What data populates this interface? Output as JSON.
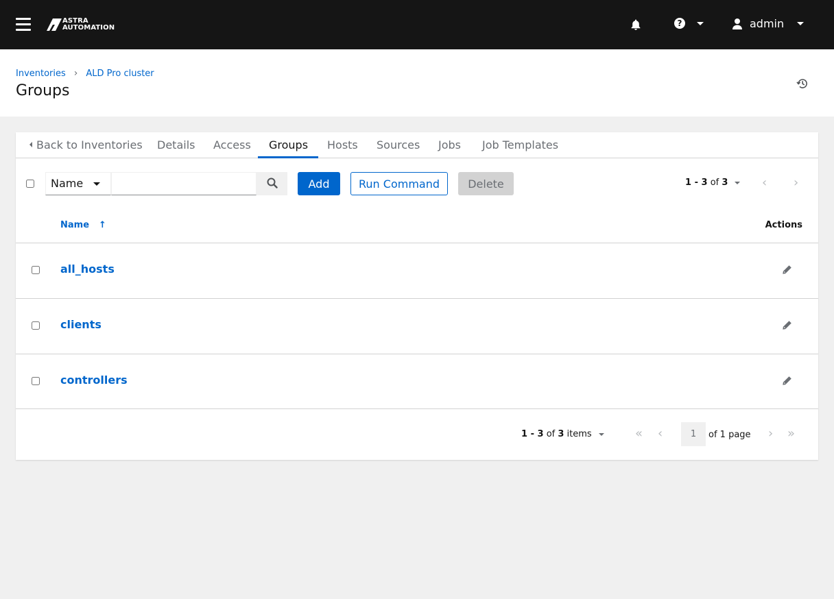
{
  "header": {
    "logo_line1": "ASTRA",
    "logo_line2": "AUTOMATION",
    "user_name": "admin",
    "help_glyph": "?"
  },
  "breadcrumb": {
    "items": [
      "Inventories",
      "ALD Pro cluster"
    ],
    "separator": "›"
  },
  "page_title": "Groups",
  "tabs": [
    {
      "label": "Back to Inventories",
      "active": false
    },
    {
      "label": "Details",
      "active": false
    },
    {
      "label": "Access",
      "active": false
    },
    {
      "label": "Groups",
      "active": true
    },
    {
      "label": "Hosts",
      "active": false
    },
    {
      "label": "Sources",
      "active": false
    },
    {
      "label": "Jobs",
      "active": false
    },
    {
      "label": "Job Templates",
      "active": false
    }
  ],
  "toolbar": {
    "filter_field": "Name",
    "search_value": "",
    "add_label": "Add",
    "run_command_label": "Run Command",
    "delete_label": "Delete"
  },
  "pagination_top": {
    "range": "1 - 3",
    "of": "of",
    "total": "3"
  },
  "table": {
    "columns": {
      "name": "Name",
      "sort_glyph": "↑",
      "actions": "Actions"
    },
    "rows": [
      {
        "name": "all_hosts"
      },
      {
        "name": "clients"
      },
      {
        "name": "controllers"
      }
    ]
  },
  "pagination_bottom": {
    "range": "1 - 3",
    "of": "of",
    "total": "3",
    "items_word": "items",
    "current_page": "1",
    "of_pages": "of 1 page"
  },
  "colors": {
    "header_bg": "#151515",
    "primary": "#0066cc",
    "page_bg": "#f0f0f0",
    "border": "#d2d2d2"
  }
}
